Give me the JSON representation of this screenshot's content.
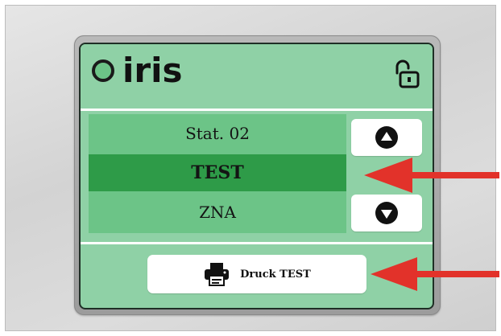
{
  "device": {
    "brand": "iris",
    "status_indicator_color": "#6cc487",
    "lock_icon": "unlocked-padlock-icon"
  },
  "station_list": {
    "items": [
      {
        "label": "Stat. 02",
        "selected": false
      },
      {
        "label": "TEST",
        "selected": true
      },
      {
        "label": "ZNA",
        "selected": false
      }
    ],
    "selected_color": "#2e9b48",
    "list_color": "#6cc487"
  },
  "controls": {
    "scroll_up_icon": "arrow-up-circle-icon",
    "scroll_down_icon": "arrow-down-circle-icon"
  },
  "print_button": {
    "icon": "printer-icon",
    "label": "Druck TEST"
  },
  "annotations": {
    "arrow_color": "#e2322a",
    "arrows": [
      "arrow-to-selected-station",
      "arrow-to-print-button"
    ]
  },
  "theme": {
    "screen_background": "#8fd1a6",
    "separator": "#ffffff"
  }
}
